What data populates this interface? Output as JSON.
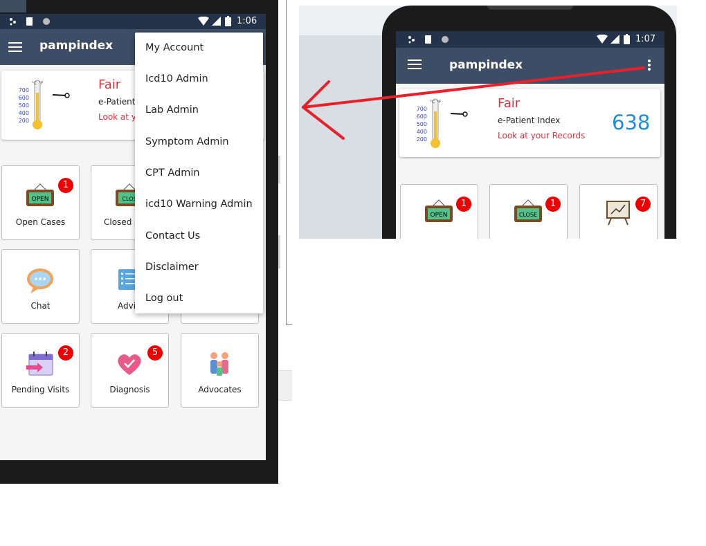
{
  "left_phone": {
    "status_time": "1:06",
    "app_title": "pampindex",
    "index_card": {
      "grade": "Fair",
      "label": "e-Patient",
      "link": "Look at y"
    },
    "thermo_scale": [
      "700",
      "600",
      "500",
      "400",
      "200"
    ],
    "tiles": [
      {
        "label": "Open Cases",
        "badge": "1"
      },
      {
        "label": "Closed C",
        "badge": ""
      },
      {
        "label": "Chat",
        "badge": ""
      },
      {
        "label": "Advi",
        "badge": ""
      },
      {
        "label": "Pending Visits",
        "badge": "2"
      },
      {
        "label": "Diagnosis",
        "badge": "5"
      },
      {
        "label": "Advocates",
        "badge": ""
      }
    ],
    "menu": [
      "My Account",
      "Icd10 Admin",
      "Lab Admin",
      "Symptom Admin",
      "CPT Admin",
      "icd10 Warning Admin",
      "Contact Us",
      "Disclaimer",
      "Log out"
    ]
  },
  "right_phone": {
    "status_time": "1:07",
    "app_title": "pampindex",
    "index_card": {
      "grade": "Fair",
      "label": "e-Patient Index",
      "link": "Look at your Records",
      "score": "638"
    },
    "thermo_scale": [
      "700",
      "600",
      "500",
      "400",
      "200"
    ],
    "tile_badges": [
      "1",
      "1",
      "7"
    ]
  },
  "icon_sign_text": {
    "open": "OPEN",
    "close": "CLOSE",
    "close_clipped": "CLOS"
  },
  "colors": {
    "app_bar": "#3e4d66",
    "status_bar": "#24324a",
    "grade_red": "#e0323e",
    "score_blue": "#1e8fd6",
    "badge_red": "#ee0000",
    "annotation_arrow": "#e8202a"
  }
}
